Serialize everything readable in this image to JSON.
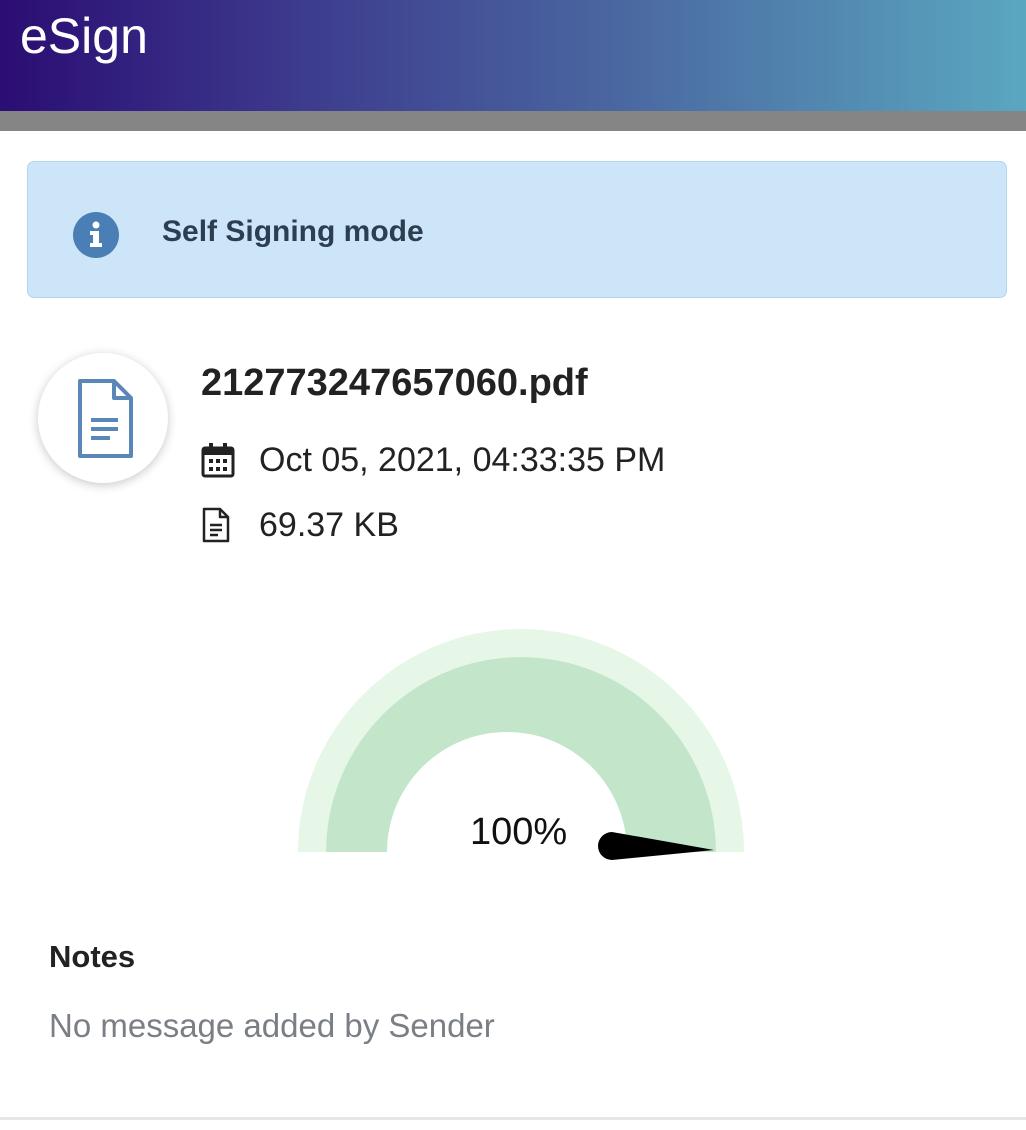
{
  "header": {
    "title": "eSign"
  },
  "alert": {
    "icon": "info-icon",
    "text": "Self Signing mode"
  },
  "document": {
    "icon": "document-icon",
    "file_name": "212773247657060.pdf",
    "date_icon": "calendar-icon",
    "date": "Oct 05, 2021, 04:33:35 PM",
    "size_icon": "file-icon",
    "size": "69.37 KB"
  },
  "progress": {
    "value_percent": 100,
    "label": "100%"
  },
  "notes": {
    "title": "Notes",
    "message": "No message added by Sender"
  },
  "colors": {
    "header_gradient_start": "#2b0d73",
    "header_gradient_end": "#5aa7c0",
    "alert_background": "#cce5f9",
    "info_icon": "#4a7fb5",
    "gauge_outer": "#e6f7e8",
    "gauge_fill": "#c3e6cb",
    "needle": "#000000"
  }
}
